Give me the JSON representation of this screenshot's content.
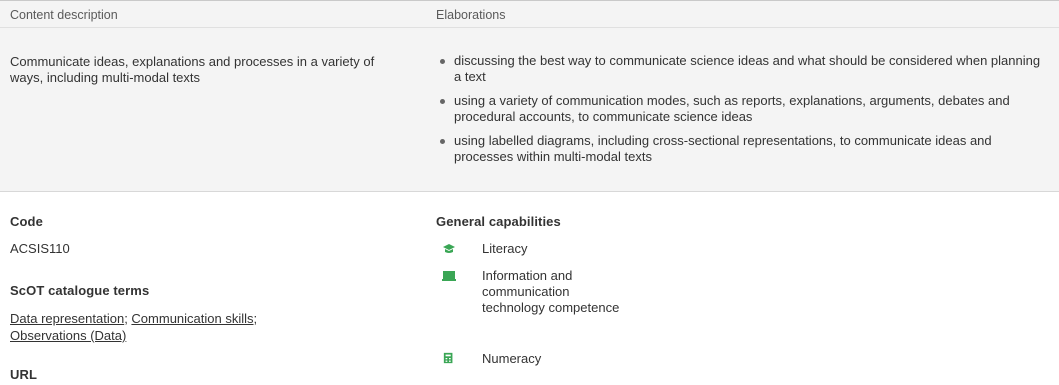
{
  "header": {
    "content_description": "Content description",
    "elaborations": "Elaborations"
  },
  "content": {
    "description": "Communicate ideas, explanations and processes in a variety of ways, including multi-modal texts",
    "elaborations": [
      "discussing the best way to communicate science ideas and what should be considered when planning a text",
      "using a variety of communication modes, such as reports, explanations, arguments, debates and procedural accounts, to communicate science ideas",
      "using labelled diagrams, including cross-sectional representations, to communicate ideas and processes within multi-modal texts"
    ]
  },
  "meta": {
    "code_label": "Code",
    "code_value": "ACSIS110",
    "scot_label": "ScOT catalogue terms",
    "scot_terms": [
      "Data representation",
      "Communication skills",
      "Observations (Data)"
    ],
    "url_label": "URL"
  },
  "capabilities": {
    "label": "General capabilities",
    "items": [
      {
        "name": "Literacy",
        "icon": "literacy-icon",
        "color": "#3aa655"
      },
      {
        "name": "Information and communication technology competence",
        "icon": "ict-icon",
        "color": "#3aa655"
      },
      {
        "name": "Numeracy",
        "icon": "numeracy-icon",
        "color": "#3aa655"
      }
    ]
  }
}
